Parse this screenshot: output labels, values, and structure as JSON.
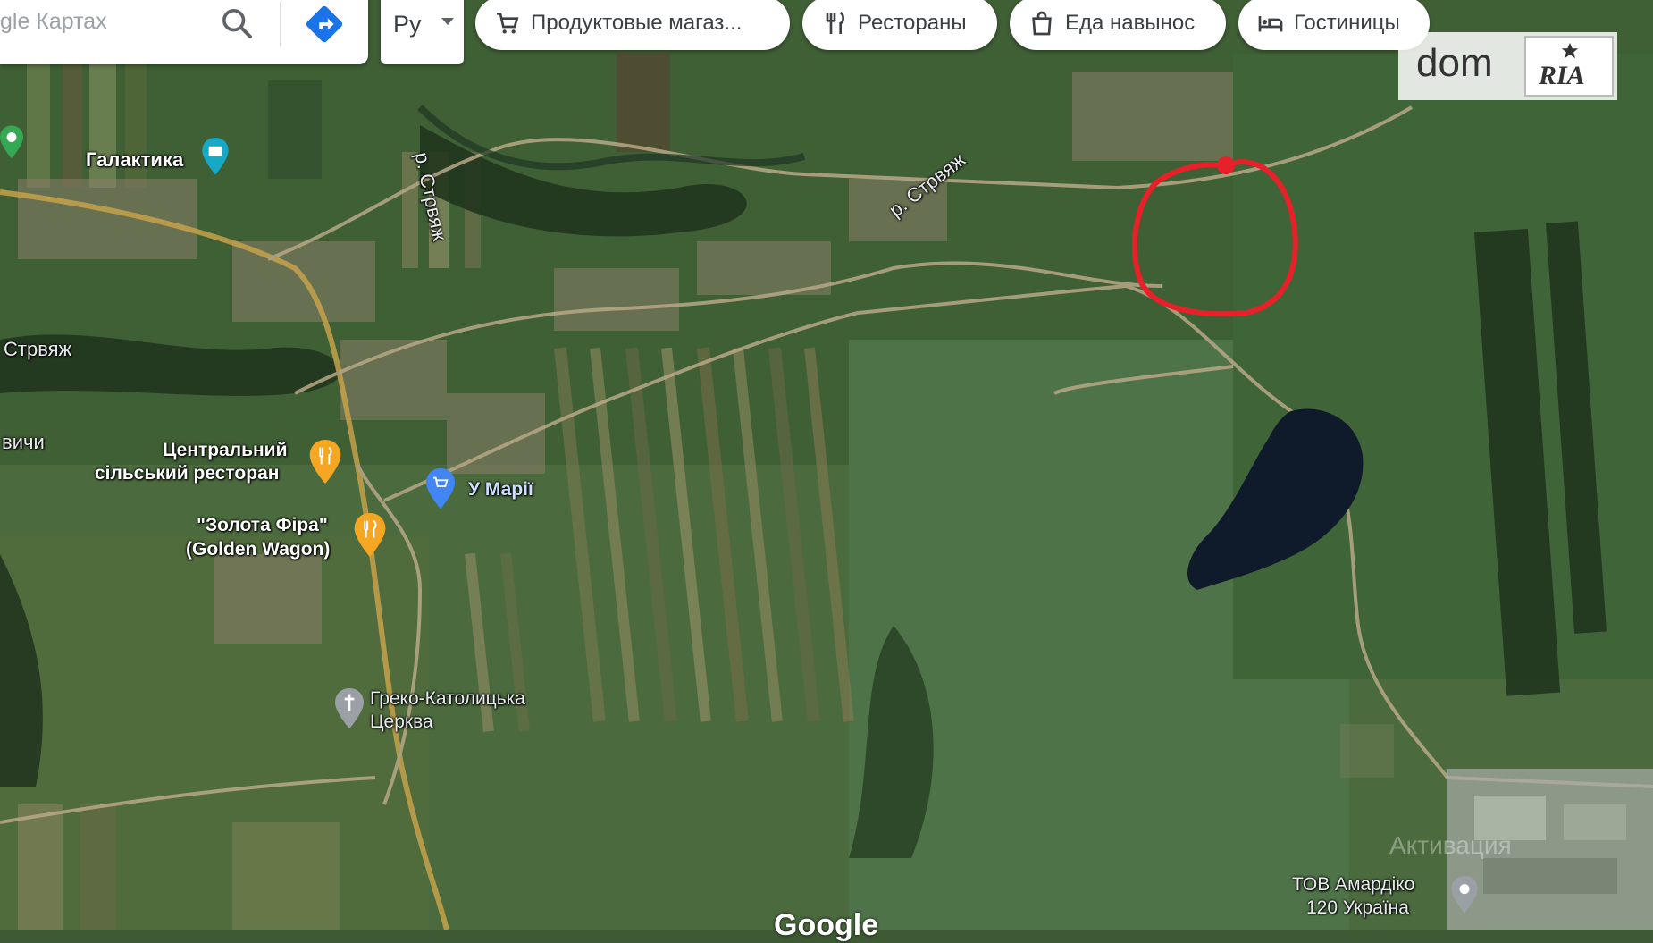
{
  "search": {
    "placeholder": "gle Картах"
  },
  "language": {
    "selected": "Ру"
  },
  "chips": [
    {
      "label": "Продуктовые магаз...",
      "icon": "cart-icon"
    },
    {
      "label": "Рестораны",
      "icon": "fork-knife-icon"
    },
    {
      "label": "Еда навынос",
      "icon": "takeout-bag-icon"
    },
    {
      "label": "Гостиницы",
      "icon": "bed-icon"
    }
  ],
  "places": {
    "galaktika": "Галактика",
    "river_1": "р. Стрвяж",
    "river_2": "р. Стрвяж",
    "strvyazh": "Стрвяж",
    "vychi": "вичи",
    "central_restaurant_line1": "Центральний",
    "central_restaurant_line2": "сільський ресторан",
    "golden_wagon_line1": "\"Золота Фіра\"",
    "golden_wagon_line2": "(Golden Wagon)",
    "u_marii": "У Марії",
    "church_line1": "Греко-Католицька",
    "church_line2": "Церква",
    "amardiko_line1": "ТОВ Амардіко",
    "amardiko_line2": "120 Україна"
  },
  "overlay": {
    "logo_dom": "dom",
    "logo_ria": "RIA",
    "google": "Google",
    "watermark": "Активация"
  },
  "colors": {
    "highlight_circle": "#e8202a",
    "restaurant_pin": "#f5a623",
    "shop_pin": "#4285f4",
    "church_pin": "#9aa0a6",
    "hotel_pin": "#16a8c4",
    "lake": "#0f1a2a"
  }
}
